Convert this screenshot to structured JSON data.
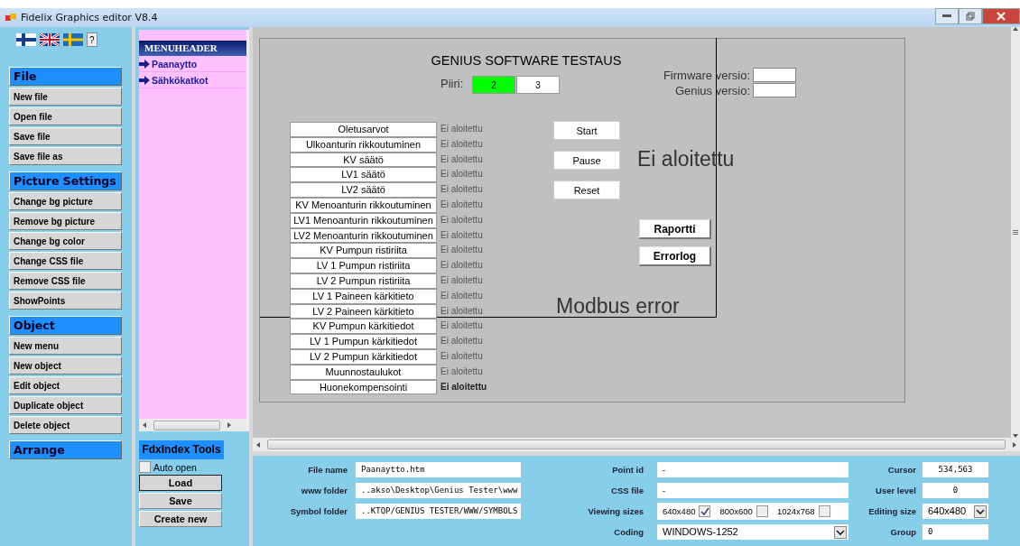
{
  "window": {
    "title": "Fidelix Graphics editor V8.4"
  },
  "help_button": "?",
  "sections": [
    {
      "title": "File",
      "buttons": [
        "New file",
        "Open file",
        "Save file",
        "Save file as"
      ]
    },
    {
      "title": "Picture Settings",
      "buttons": [
        "Change bg picture",
        "Remove bg picture",
        "Change bg color",
        "Change CSS file",
        "Remove CSS file",
        "ShowPoints"
      ]
    },
    {
      "title": "Object",
      "buttons": [
        "New menu",
        "New object",
        "Edit object",
        "Duplicate object",
        "Delete object"
      ]
    },
    {
      "title": "Arrange"
    }
  ],
  "menu": {
    "header": "MENUHEADER",
    "items": [
      "Paanaytto",
      "Sähkökatkot"
    ]
  },
  "tools": {
    "title": "FdxIndex Tools",
    "auto_open": {
      "label": "Auto open",
      "checked": false
    },
    "buttons": [
      {
        "label": "Load",
        "focused": true
      },
      {
        "label": "Save",
        "focused": false
      },
      {
        "label": "Create new",
        "focused": false
      }
    ]
  },
  "canvas": {
    "title": "GENIUS SOFTWARE TESTAUS",
    "circuit_label": "Piiri:",
    "circuits": [
      {
        "label": "2",
        "selected": true
      },
      {
        "label": "3",
        "selected": false
      }
    ],
    "versions": [
      {
        "label": "Firmware versio:"
      },
      {
        "label": "Genius versio:"
      }
    ],
    "tests": [
      {
        "name": "Oletusarvot",
        "status": "Ei aloitettu",
        "bold": false
      },
      {
        "name": "Ulkoanturin rikkoutuminen",
        "status": "Ei aloitettu",
        "bold": false
      },
      {
        "name": "KV säätö",
        "status": "Ei aloitettu",
        "bold": false
      },
      {
        "name": "LV1 säätö",
        "status": "Ei aloitettu",
        "bold": false
      },
      {
        "name": "LV2 säätö",
        "status": "Ei aloitettu",
        "bold": false
      },
      {
        "name": "KV Menoanturin rikkoutuminen",
        "status": "Ei aloitettu",
        "bold": false
      },
      {
        "name": "LV1 Menoanturin rikkoutuminen",
        "status": "Ei aloitettu",
        "bold": false
      },
      {
        "name": "LV2 Menoanturin rikkoutuminen",
        "status": "Ei aloitettu",
        "bold": false
      },
      {
        "name": "KV Pumpun ristiriita",
        "status": "Ei aloitettu",
        "bold": false
      },
      {
        "name": "LV 1 Pumpun ristiriita",
        "status": "Ei aloitettu",
        "bold": false
      },
      {
        "name": "LV 2 Pumpun ristiriita",
        "status": "Ei aloitettu",
        "bold": false
      },
      {
        "name": "LV 1 Paineen kärkitieto",
        "status": "Ei aloitettu",
        "bold": false
      },
      {
        "name": "LV 2 Paineen kärkitieto",
        "status": "Ei aloitettu",
        "bold": false
      },
      {
        "name": "KV Pumpun kärkitiedot",
        "status": "Ei aloitettu",
        "bold": false
      },
      {
        "name": "LV 1 Pumpun kärkitiedot",
        "status": "Ei aloitettu",
        "bold": false
      },
      {
        "name": "LV 2 Pumpun kärkitiedot",
        "status": "Ei aloitettu",
        "bold": false
      },
      {
        "name": "Muunnostaulukot",
        "status": "Ei aloitettu",
        "bold": false
      },
      {
        "name": "Huonekompensointi",
        "status": "Ei aloitettu",
        "bold": true
      }
    ],
    "controls": [
      "Start",
      "Pause",
      "Reset"
    ],
    "overall_status": "Ei aloitettu",
    "report_buttons": [
      "Raportti",
      "Errorlog"
    ],
    "error": "Modbus error"
  },
  "properties": {
    "file_name": {
      "label": "File name",
      "value": "Paanaytto.htm"
    },
    "www_folder": {
      "label": "www folder",
      "value": "..akso\\Desktop\\Genius Tester\\www"
    },
    "symbol_folder": {
      "label": "Symbol folder",
      "value": "..KTOP/GENIUS TESTER/WWW/SYMBOLS"
    },
    "point_id": {
      "label": "Point id",
      "value": "-"
    },
    "css_file": {
      "label": "CSS file",
      "value": "-"
    },
    "viewing_sizes": {
      "label": "Viewing sizes",
      "options": [
        {
          "label": "640x480",
          "checked": true
        },
        {
          "label": "800x600",
          "checked": false
        },
        {
          "label": "1024x768",
          "checked": false
        }
      ]
    },
    "coding": {
      "label": "Coding",
      "value": "WINDOWS-1252"
    },
    "cursor": {
      "label": "Cursor",
      "value": "534,563"
    },
    "user_level": {
      "label": "User level",
      "value": "0"
    },
    "editing_size": {
      "label": "Editing size",
      "value": "640x480"
    },
    "group": {
      "label": "Group",
      "value": "0"
    }
  }
}
